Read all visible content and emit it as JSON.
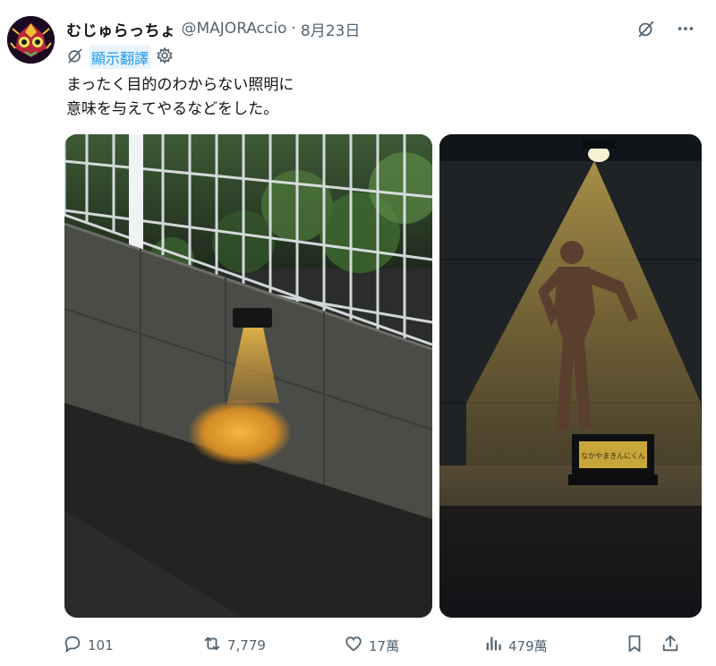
{
  "user": {
    "display_name": "むじゅらっちょ",
    "handle": "@MAJORAccio",
    "separator": "·",
    "date": "8月23日"
  },
  "translate": {
    "label": "顯示翻譯"
  },
  "tweet": {
    "text": "まったく目的のわからない照明に\n意味を与えてやるなどをした。"
  },
  "photo2": {
    "sign_text": "なかやまきんにくん"
  },
  "actions": {
    "replies": "101",
    "retweets": "7,779",
    "likes": "17萬",
    "views": "479萬"
  },
  "colors": {
    "accent": "#1d9bf0",
    "muted": "#536471",
    "text": "#0f1419"
  },
  "icons": [
    "grok-icon",
    "more-icon",
    "translate-icon",
    "settings-icon",
    "reply-icon",
    "retweet-icon",
    "like-icon",
    "views-icon",
    "bookmark-icon",
    "share-icon"
  ]
}
